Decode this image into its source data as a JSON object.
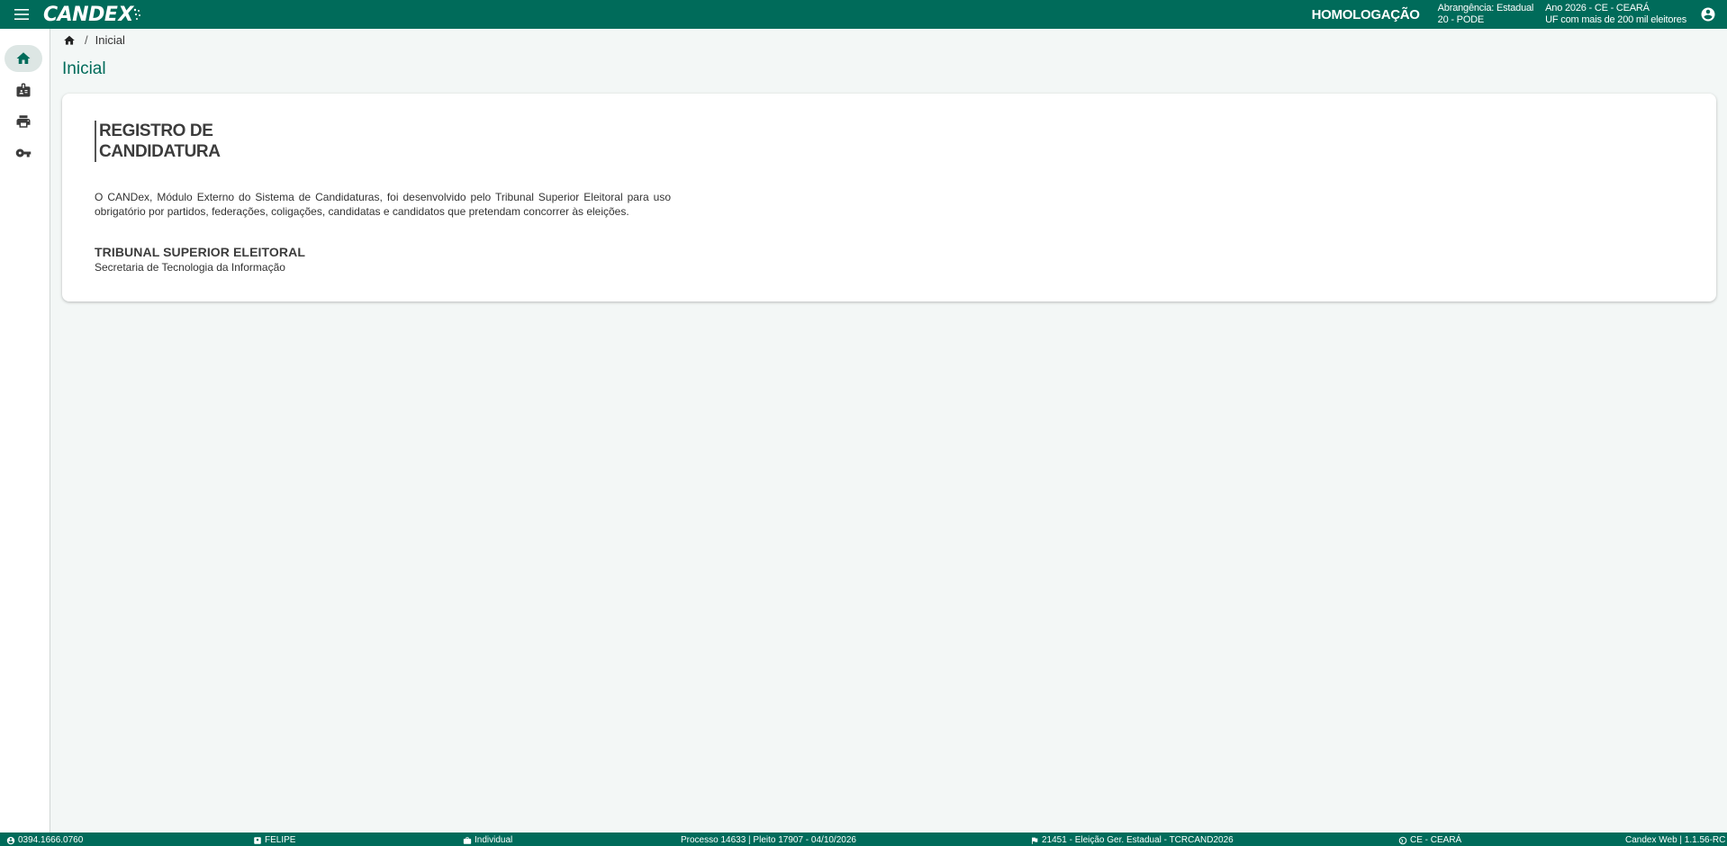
{
  "header": {
    "logo_text": "CANDE",
    "logo_x": "X",
    "environment": "HOMOLOGAÇÃO",
    "scope_line1": "Abrangência: Estadual",
    "scope_line2": "20 - PODE",
    "year_line1": "Ano 2026 - CE - CEARÁ",
    "year_line2": "UF com mais de 200 mil eleitores",
    "icons": {
      "menu": "menu-icon",
      "user": "account-circle-icon"
    }
  },
  "sidebar": {
    "items": [
      {
        "name": "home",
        "icon": "home-icon",
        "active": true
      },
      {
        "name": "candidate",
        "icon": "badge-icon",
        "active": false
      },
      {
        "name": "print",
        "icon": "print-icon",
        "active": false
      },
      {
        "name": "key",
        "icon": "key-icon",
        "active": false
      }
    ]
  },
  "breadcrumb": {
    "separator": "/",
    "current": "Inicial"
  },
  "page": {
    "title": "Inicial"
  },
  "card": {
    "heading_line1": "REGISTRO DE",
    "heading_line2": "CANDIDATURA",
    "description": "O CANDex, Módulo Externo do Sistema de Candidaturas, foi desenvolvido pelo Tribunal Superior Eleitoral para uso obrigatório por partidos, federações, coligações, candidatas e candidatos que pretendam concorrer às eleições.",
    "org_name": "TRIBUNAL SUPERIOR ELEITORAL",
    "org_sub": "Secretaria de Tecnologia da Informação"
  },
  "status_bar": {
    "user_id": "0394.1666.0760",
    "user_name": "FELIPE",
    "mode": "Individual",
    "process": "Processo 14633 | Pleito 17907 - 04/10/2026",
    "election": "21451 - Eleição Ger. Estadual - TCRCAND2026",
    "uf": "CE - CEARÁ",
    "version": "Candex Web | 1.1.56-RC"
  },
  "colors": {
    "primary": "#006b5a",
    "background": "#f3f7f6",
    "active_item": "#dde6e4"
  }
}
